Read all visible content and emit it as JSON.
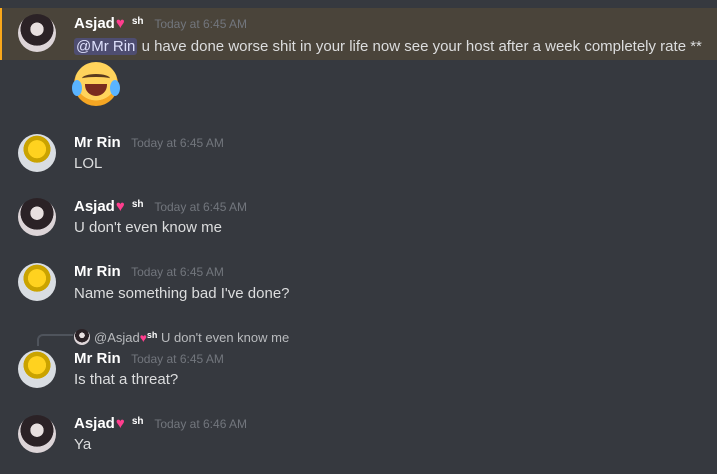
{
  "messages": [
    {
      "username": "Asjad",
      "badge_sh": "sh",
      "timestamp": "Today at 6:45 AM",
      "mention": "@Mr Rin",
      "text": "u have done worse shit in your life now see your host after a week completely rate **",
      "emoji": "joy-emoji"
    },
    {
      "username": "Mr Rin",
      "timestamp": "Today at 6:45 AM",
      "text": "LOL"
    },
    {
      "username": "Asjad",
      "badge_sh": "sh",
      "timestamp": "Today at 6:45 AM",
      "text": "U don't even know me"
    },
    {
      "username": "Mr Rin",
      "timestamp": "Today at 6:45 AM",
      "text": "Name something bad I've done?"
    },
    {
      "reply": {
        "mention": "@Asjad",
        "badge_sh": "sh",
        "text": "U don't even know me"
      },
      "username": "Mr Rin",
      "timestamp": "Today at 6:45 AM",
      "text": "Is that a threat?"
    },
    {
      "username": "Asjad",
      "badge_sh": "sh",
      "timestamp": "Today at 6:46 AM",
      "text": "Ya"
    }
  ],
  "colors": {
    "background": "#36393f",
    "highlight": "#4a443a",
    "highlight_bar": "#faa81a",
    "mention_bg": "#3f4480",
    "username": "#ffffff",
    "timestamp": "#72767d"
  }
}
